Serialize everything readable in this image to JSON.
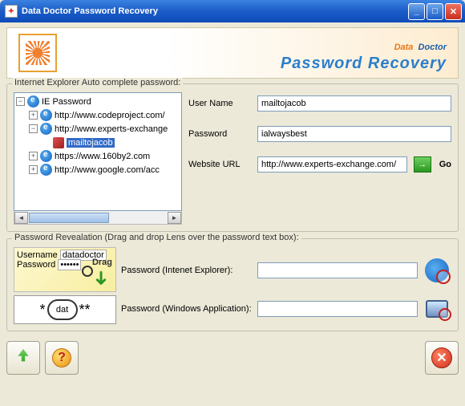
{
  "window": {
    "title": "Data Doctor Password Recovery"
  },
  "banner": {
    "word1": "Data",
    "word2": "Doctor",
    "line2": "Password Recovery"
  },
  "group1_label": "Internet Explorer Auto complete password:",
  "tree": {
    "root": "IE Password",
    "items": [
      "http://www.codeproject.com/",
      "http://www.experts-exchange",
      "mailtojacob",
      "https://www.160by2.com",
      "http://www.google.com/acc"
    ]
  },
  "form": {
    "username_label": "User Name",
    "username_value": "mailtojacob",
    "password_label": "Password",
    "password_value": "ialwaysbest",
    "url_label": "Website URL",
    "url_value": "http://www.experts-exchange.com/",
    "go_label": "Go"
  },
  "group2_label": "Password Revealation (Drag and drop Lens over the password text box):",
  "reveal": {
    "thumb_user_lbl": "Username",
    "thumb_user_val": "datadoctor",
    "thumb_pass_lbl": "Password",
    "thumb_drag": "Drag",
    "thumb_zoom": "dat",
    "ie_label": "Password (Intenet Explorer):",
    "win_label": "Password (Windows Application):"
  }
}
